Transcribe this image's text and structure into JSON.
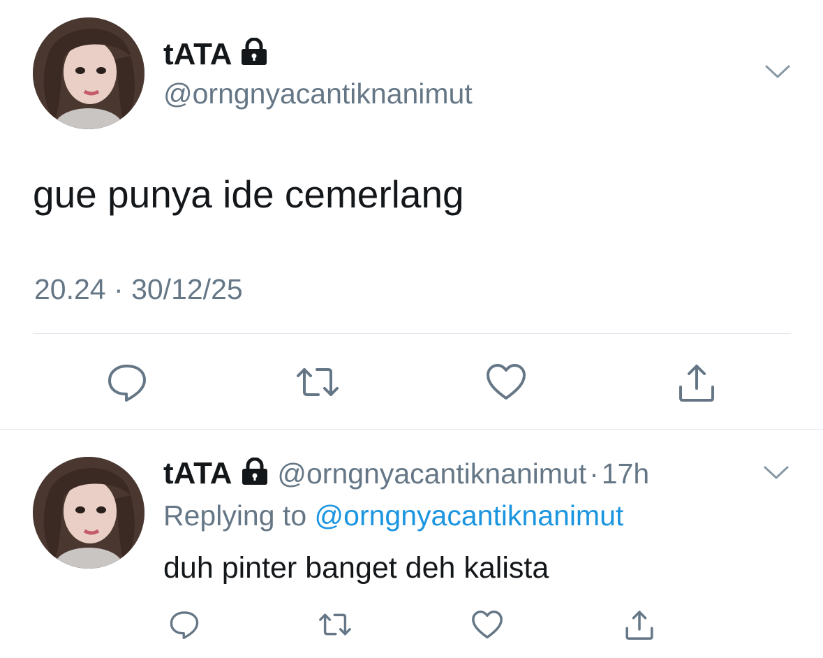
{
  "main_tweet": {
    "display_name": "tATA",
    "handle": "@orngnyacantiknanimut",
    "text": "gue punya ide cemerlang",
    "time": "20.24",
    "separator": "·",
    "date": "30/12/25"
  },
  "reply": {
    "display_name": "tATA",
    "handle": "@orngnyacantiknanimut",
    "separator": "·",
    "age": "17h",
    "replying_prefix": "Replying to",
    "replying_handle": "@orngnyacantiknanimut",
    "text": "duh pinter banget deh kalista"
  },
  "icons": {
    "lock": "lock-icon",
    "more": "chevron-down-icon",
    "reply": "comment-icon",
    "retweet": "retweet-icon",
    "like": "heart-icon",
    "share": "share-icon"
  },
  "colors": {
    "text": "#14171a",
    "secondary": "#657786",
    "link": "#1b95e0",
    "divider": "#e1e8ed"
  }
}
